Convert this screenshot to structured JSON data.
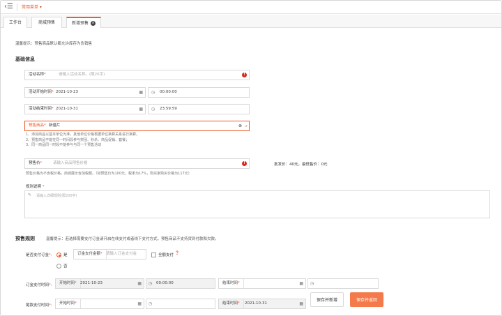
{
  "topbar": {
    "common_menu": "常用菜单 ▾"
  },
  "tabs": [
    {
      "label": "工作台"
    },
    {
      "label": "商城预售"
    },
    {
      "label": "新增预售"
    }
  ],
  "tip_top": "温馨提示：预售商品默认都允许库存为负销售",
  "basic": {
    "title": "基础信息",
    "activity_name_label": "活动名称",
    "activity_name_placeholder": "请输入活动名称。(限20字)",
    "start_time_label": "活动开始时间",
    "start_date": "2021-10-23",
    "start_clock": "00:00:00",
    "end_time_label": "活动结束时间",
    "end_date": "2021-10-31",
    "end_clock": "23:59:59",
    "product_label": "预售商品",
    "product_value": "新疆片",
    "notes": [
      "1、添加商品以基本单位为准，其他单位价格根据单位换算关系进行换算。",
      "2、预售商品不能在同一时间段参与拼团、秒杀、商品促销、套餐；",
      "3、同一商品同一时段不能参与与同一个预售活动"
    ],
    "price_label": "预售价",
    "price_placeholder": "请输入商品预售价格",
    "price_info": "批发价：40元，最低售价：0元",
    "price_note": "预售价格为不含税价格，商城展示含加税额。（如预售价为100元，税率为17%，则买家购买价格为117元）",
    "rules_label": "规则说明",
    "rules_placeholder": "请输入详细规则(限200字)"
  },
  "presale": {
    "title": "预售规则",
    "tip": "温馨提示：若选择需要支付订金请开启在线支付或者线下支付方式，预售商品不支持货到付款和欠款。",
    "deposit_q_label": "是否支付订金",
    "yes": "是",
    "no": "否",
    "deposit_amount_label": "订金支付金额",
    "deposit_amount_placeholder": "请输入订金支付金",
    "full_pay_label": "全额支付",
    "deposit_time_label": "订金支付时间",
    "start_label": "开始时间",
    "deposit_start_date": "2021-10-23",
    "deposit_start_clock": "00:00:00",
    "end_label": "结束时间",
    "balance_time_label": "尾款支付时间",
    "balance_end_date": "2021-10-31"
  },
  "buttons": {
    "save_new": "保存并新增",
    "save_back": "保存并返回"
  },
  "colors": {
    "accent": "#f05a28",
    "primary_button": "#f47a4b",
    "error": "#d9261c"
  }
}
